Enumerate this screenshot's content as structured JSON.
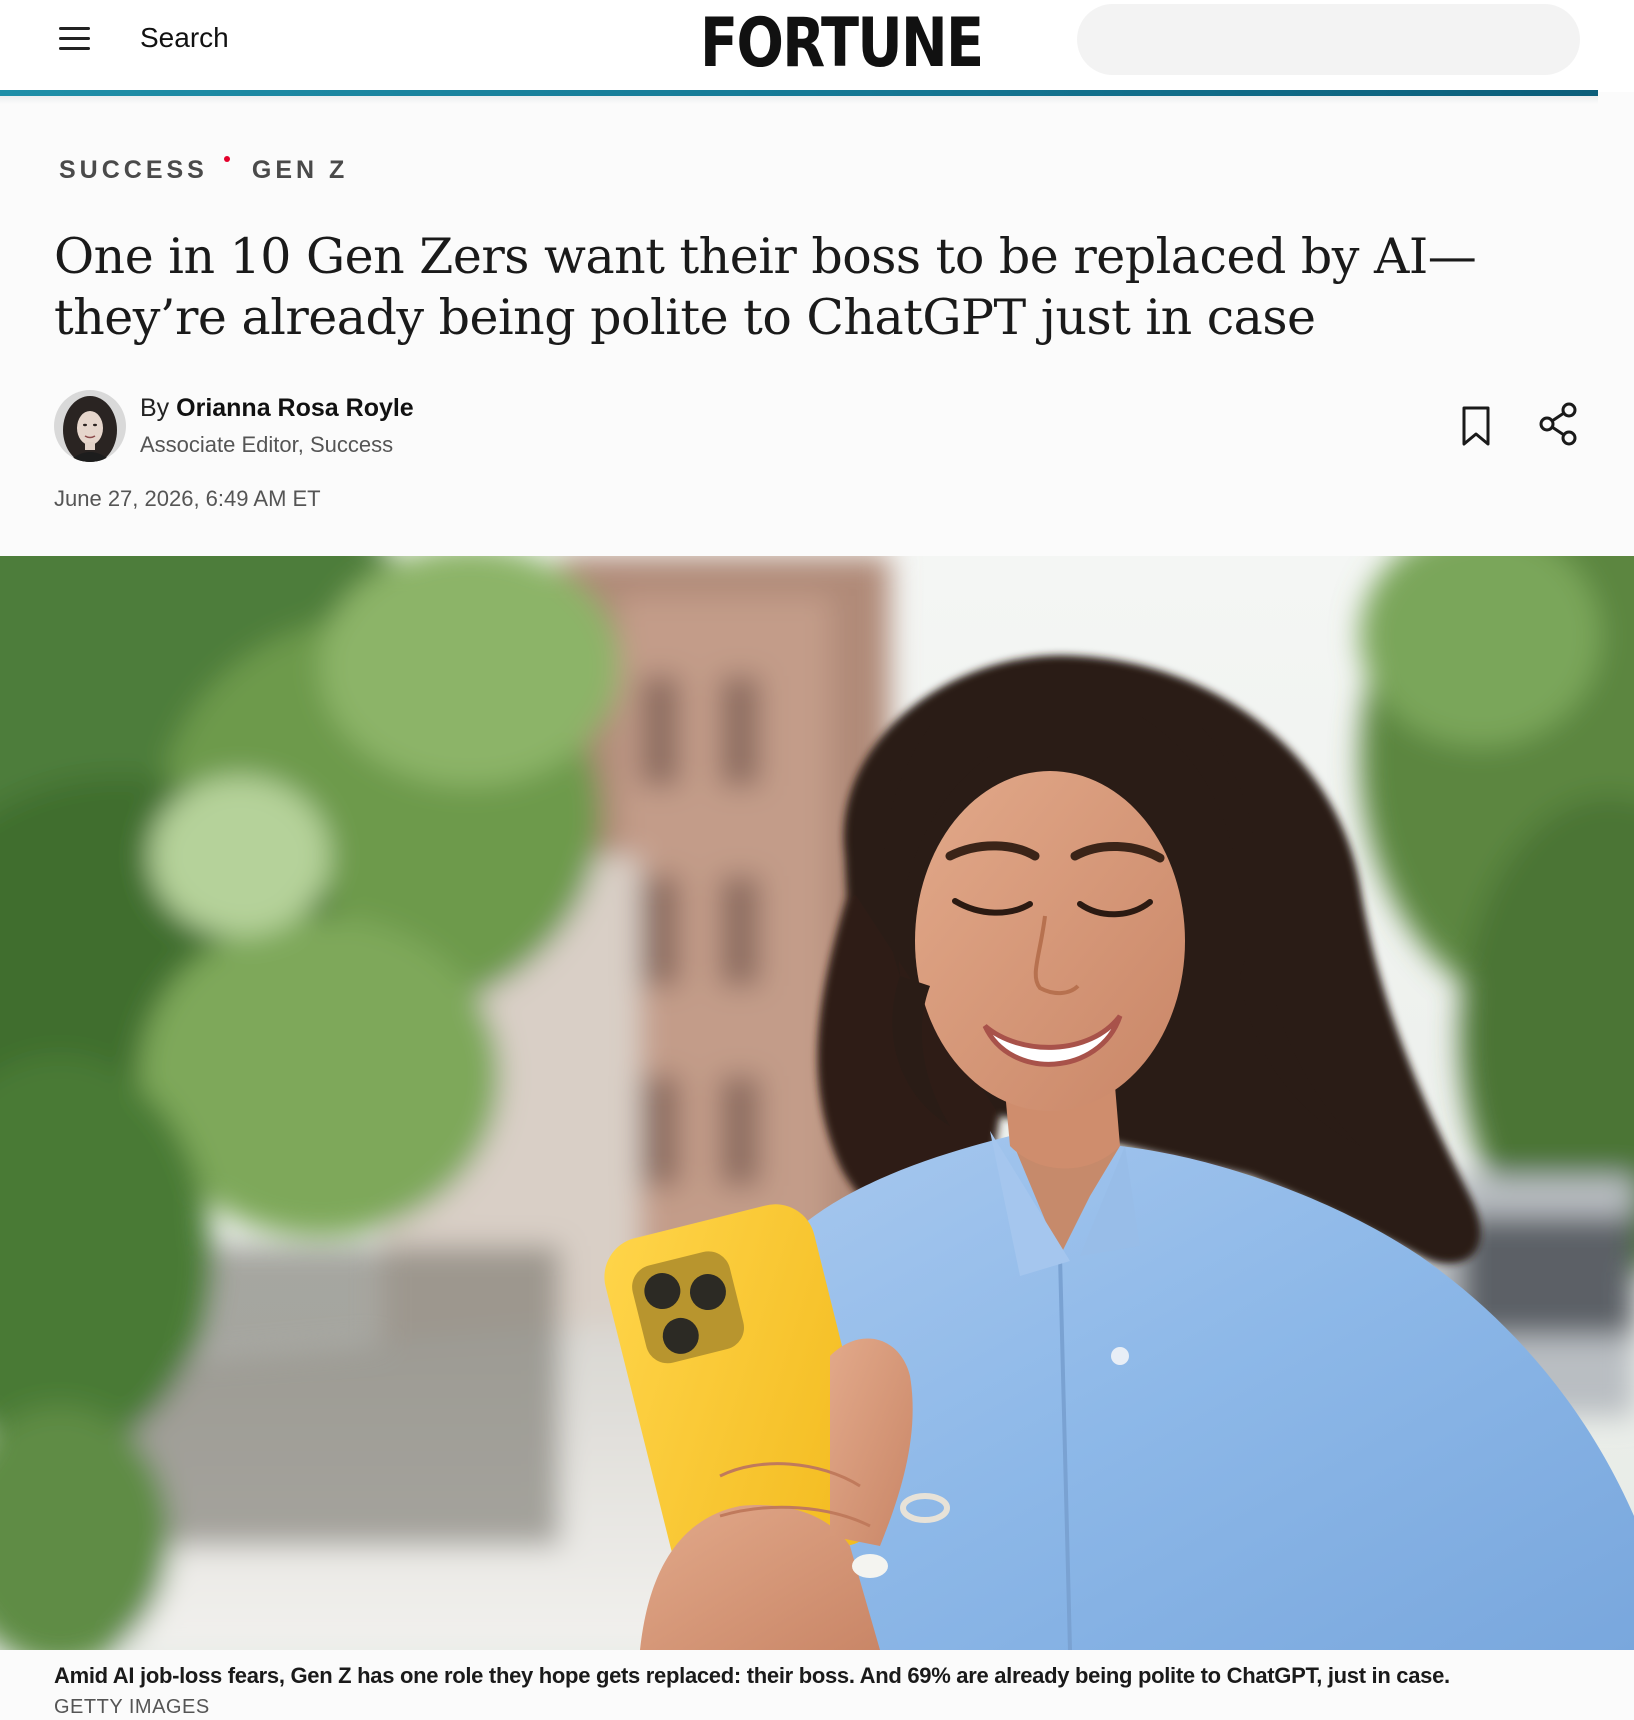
{
  "header": {
    "search_label": "Search",
    "brand": "FORTUNE",
    "search_placeholder": ""
  },
  "article": {
    "tags": [
      "SUCCESS",
      "GEN Z"
    ],
    "headline": "One in 10 Gen Zers want their boss to be replaced by AI—they’re already being polite to ChatGPT just in case",
    "byline_prefix": "By",
    "author_name": "Orianna Rosa Royle",
    "author_role": "Associate Editor, Success",
    "date": "June 27, 2026, 6:49 AM ET",
    "caption": "Amid AI job-loss fears, Gen Z has one role they hope gets replaced: their boss. And 69% are already being polite to ChatGPT, just in case.",
    "credit": "GETTY IMAGES"
  },
  "icons": {
    "menu": "hamburger-menu-icon",
    "bookmark": "bookmark-icon",
    "share": "share-icon"
  },
  "colors": {
    "accent_rule": "#167a96",
    "tag_dot": "#e4002b"
  }
}
